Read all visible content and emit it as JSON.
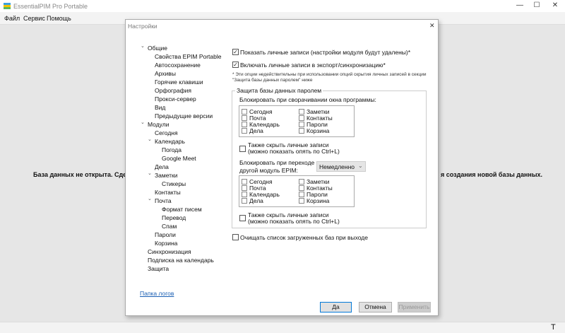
{
  "app": {
    "title": "EssentialPIM Pro Portable",
    "menu": [
      "Файл",
      "Сервис",
      "Помощь"
    ],
    "window_controls": {
      "minimize": "—",
      "maximize": "☐",
      "close": "✕"
    },
    "background_text_left": "База данных не открыта. Сдела",
    "background_text_right": "я создания новой базы данных.",
    "status_icon": "T"
  },
  "dialog": {
    "title": "Настройки",
    "close": "✕",
    "tree": [
      {
        "label": "Общие",
        "level": 0,
        "expander": true
      },
      {
        "label": "Свойства EPIM Portable",
        "level": 1
      },
      {
        "label": "Автосохранение",
        "level": 1
      },
      {
        "label": "Архивы",
        "level": 1
      },
      {
        "label": "Горячие клавиши",
        "level": 1
      },
      {
        "label": "Орфография",
        "level": 1
      },
      {
        "label": "Прокси-сервер",
        "level": 1
      },
      {
        "label": "Вид",
        "level": 1
      },
      {
        "label": "Предыдущие версии",
        "level": 1
      },
      {
        "label": "Модули",
        "level": 0,
        "expander": true
      },
      {
        "label": "Сегодня",
        "level": 1
      },
      {
        "label": "Календарь",
        "level": 1,
        "expander": true
      },
      {
        "label": "Погода",
        "level": 2
      },
      {
        "label": "Google Meet",
        "level": 2
      },
      {
        "label": "Дела",
        "level": 1
      },
      {
        "label": "Заметки",
        "level": 1,
        "expander": true
      },
      {
        "label": "Стикеры",
        "level": 2
      },
      {
        "label": "Контакты",
        "level": 1
      },
      {
        "label": "Почта",
        "level": 1,
        "expander": true
      },
      {
        "label": "Формат писем",
        "level": 2
      },
      {
        "label": "Перевод",
        "level": 2
      },
      {
        "label": "Спам",
        "level": 2
      },
      {
        "label": "Пароли",
        "level": 1
      },
      {
        "label": "Корзина",
        "level": 1
      },
      {
        "label": "Синхронизация",
        "level": 0
      },
      {
        "label": "Подписка на календарь",
        "level": 0
      },
      {
        "label": "Защита",
        "level": 0
      }
    ],
    "logs_link": "Папка логов",
    "show_private": {
      "label": "Показать личные записи (настройки модуля будут удалены)*",
      "checked": true
    },
    "include_private": {
      "label": "Включать личные записи в экспорт/синхронизацию*",
      "checked": true
    },
    "note_line1": "* Эти опции недействительны при использовании опций скрытия личных записей в секции",
    "note_line2": "\"Защита базы данных паролем\" ниже",
    "group_title": "Защита базы данных паролем",
    "minimize_label": "Блокировать при сворачивании окна программы:",
    "modules_col1": [
      "Сегодня",
      "Почта",
      "Календарь",
      "Дела"
    ],
    "modules_col2": [
      "Заметки",
      "Контакты",
      "Пароли",
      "Корзина"
    ],
    "hide_line1": "Также скрыть личные записи",
    "hide_line2": "(можно показать опять по Ctrl+L)",
    "switch_label1": "Блокировать при переходе на",
    "switch_label2": "другой модуль EPIM:",
    "switch_select": "Немедленно",
    "clear_list": {
      "label": "Очищать список загруженных баз при выходе",
      "checked": false
    },
    "buttons": {
      "ok": "Да",
      "cancel": "Отмена",
      "apply": "Применить"
    }
  }
}
